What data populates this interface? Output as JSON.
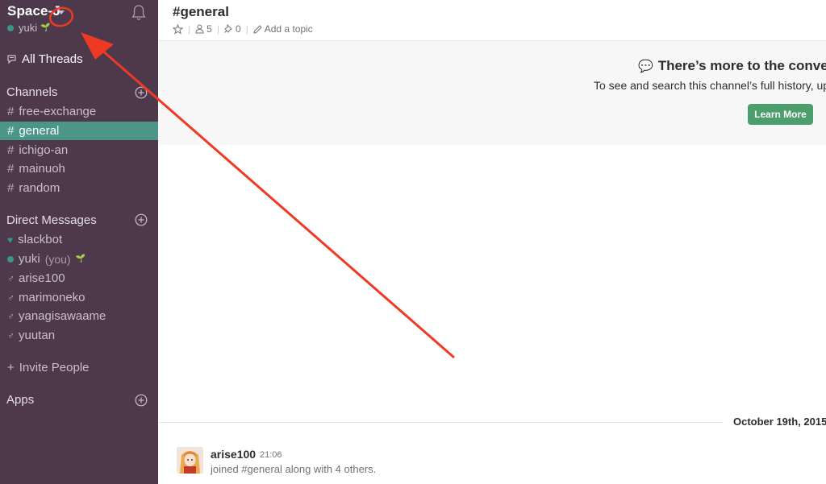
{
  "sidebar": {
    "team_name": "Space-J",
    "user_name": "yuki",
    "all_threads_label": "All Threads",
    "channels_heading": "Channels",
    "channels": [
      {
        "label": "free-exchange",
        "active": false
      },
      {
        "label": "general",
        "active": true
      },
      {
        "label": "ichigo-an",
        "active": false
      },
      {
        "label": "mainuoh",
        "active": false
      },
      {
        "label": "random",
        "active": false
      }
    ],
    "dm_heading": "Direct Messages",
    "direct_messages": [
      {
        "label": "slackbot"
      },
      {
        "label": "yuki",
        "suffix": "(you)"
      },
      {
        "label": "arise100"
      },
      {
        "label": "marimoneko"
      },
      {
        "label": "yanagisawaame"
      },
      {
        "label": "yuutan"
      }
    ],
    "invite_label": "Invite People",
    "apps_heading": "Apps"
  },
  "header": {
    "channel_title": "#general",
    "member_count": "5",
    "pinned_count": "0",
    "add_topic_label": "Add a topic"
  },
  "banner": {
    "title": "There’s more to the conversa",
    "subtitle": "To see and search this channel’s full history, upgr",
    "button_label": "Learn More"
  },
  "messages": {
    "date_divider": "October 19th, 2015",
    "items": [
      {
        "author": "arise100",
        "time": "21:06",
        "text": "joined #general along with 4 others."
      }
    ]
  },
  "colors": {
    "sidebar_bg": "#4d394b",
    "active_channel": "#4c9689",
    "presence": "#38978d",
    "learn_more_button": "#4c9e6a",
    "annotation_red": "#ee3a24"
  },
  "icons": [
    "bell-icon",
    "threads-icon",
    "add-circle-icon",
    "star-icon",
    "member-icon",
    "pin-icon",
    "pencil-icon",
    "speech-bubble-icon",
    "heart-icon",
    "gender-icon"
  ]
}
